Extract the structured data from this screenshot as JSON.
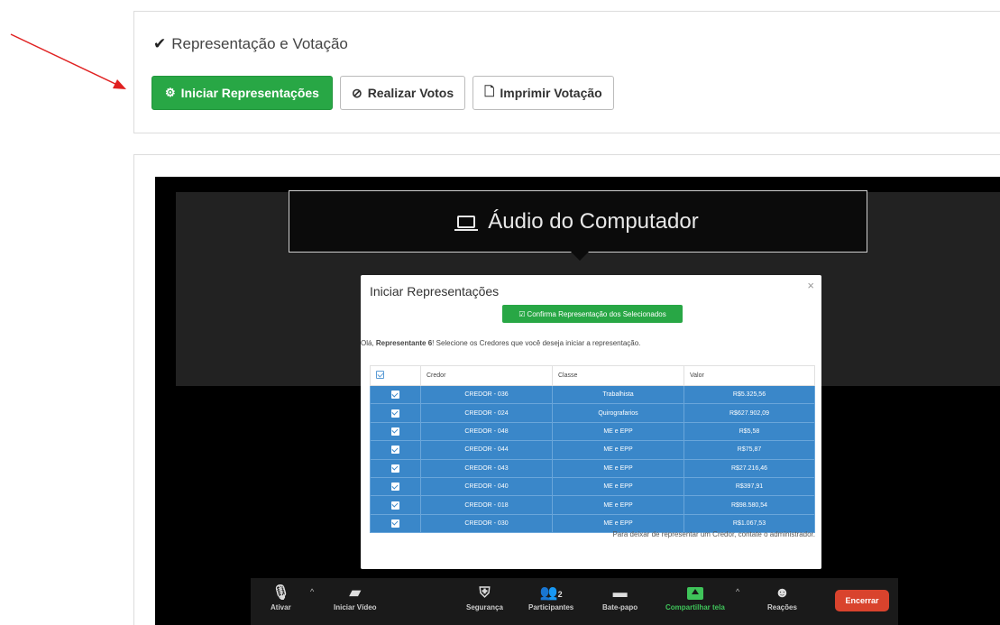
{
  "panel": {
    "title": "Representação e Votação",
    "buttons": {
      "start": "Iniciar Representações",
      "vote": "Realizar Votos",
      "print": "Imprimir Votação"
    }
  },
  "audio": {
    "label": "Áudio do Computador"
  },
  "modal": {
    "title": "Iniciar Representações",
    "close": "×",
    "confirm": "Confirma Representação dos Selecionados",
    "greeting_prefix": "Olá, ",
    "greeting_name": "Representante 6",
    "greeting_suffix": "! Selecione os Credores que você deseja iniciar a representação.",
    "columns": [
      "Credor",
      "Classe",
      "Valor"
    ],
    "rows": [
      {
        "credor": "CREDOR - 036",
        "classe": "Trabalhista",
        "valor": "R$5.325,56"
      },
      {
        "credor": "CREDOR - 024",
        "classe": "Quirografarios",
        "valor": "R$627.902,09"
      },
      {
        "credor": "CREDOR - 048",
        "classe": "ME e EPP",
        "valor": "R$5,58"
      },
      {
        "credor": "CREDOR - 044",
        "classe": "ME e EPP",
        "valor": "R$75,87"
      },
      {
        "credor": "CREDOR - 043",
        "classe": "ME e EPP",
        "valor": "R$27.216,46"
      },
      {
        "credor": "CREDOR - 040",
        "classe": "ME e EPP",
        "valor": "R$397,91"
      },
      {
        "credor": "CREDOR - 018",
        "classe": "ME e EPP",
        "valor": "R$98.580,54"
      },
      {
        "credor": "CREDOR - 030",
        "classe": "ME e EPP",
        "valor": "R$1.067,53"
      }
    ],
    "footnote": "Para deixar de representar um Credor, contate o administrador."
  },
  "toolbar": {
    "mute": "Ativar",
    "video": "Iniciar Vídeo",
    "security": "Segurança",
    "participants": "Participantes",
    "participants_count": "2",
    "chat": "Bate-papo",
    "share": "Compartilhar tela",
    "reactions": "Reações",
    "end": "Encerrar"
  },
  "colors": {
    "green": "#28a745",
    "row_blue": "#3a87c9",
    "zoom_end": "#d9432d",
    "annotation_arrow": "#e02020"
  },
  "icons": [
    "check-icon",
    "cogs-icon",
    "check-circle-icon",
    "pdf-icon",
    "laptop-icon",
    "close-icon",
    "checkbox-icon",
    "mic-muted-icon",
    "video-off-icon",
    "shield-icon",
    "participants-icon",
    "chat-icon",
    "share-screen-icon",
    "reaction-icon",
    "caret-up-icon"
  ]
}
